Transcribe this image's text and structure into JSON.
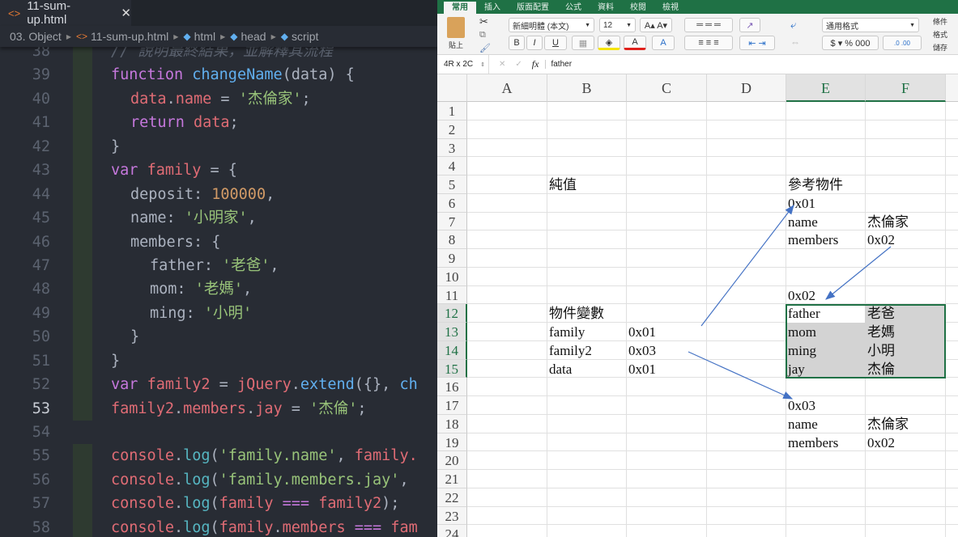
{
  "editor": {
    "tab": {
      "title": "11-sum-up.html",
      "close": "✕",
      "icon": "<>"
    },
    "breadcrumbs": [
      "03. Object",
      "11-sum-up.html",
      "html",
      "head",
      "script"
    ],
    "current_line": 53,
    "lines": [
      {
        "n": 38,
        "ind": 0,
        "t": [
          [
            "// 說明最終結果，並解釋其流程",
            "c"
          ]
        ]
      },
      {
        "n": 39,
        "ind": 0,
        "t": [
          [
            "function ",
            "k"
          ],
          [
            "changeName",
            "f"
          ],
          [
            "(data) {",
            "p"
          ]
        ]
      },
      {
        "n": 40,
        "ind": 1,
        "t": [
          [
            "data",
            "v"
          ],
          [
            ".",
            "p"
          ],
          [
            "name",
            "v"
          ],
          [
            " = ",
            "p"
          ],
          [
            "'杰倫家'",
            "s"
          ],
          [
            ";",
            "p"
          ]
        ]
      },
      {
        "n": 41,
        "ind": 1,
        "t": [
          [
            "return ",
            "k"
          ],
          [
            "data",
            "v"
          ],
          [
            ";",
            "p"
          ]
        ]
      },
      {
        "n": 42,
        "ind": 0,
        "t": [
          [
            "}",
            "p"
          ]
        ]
      },
      {
        "n": 43,
        "ind": 0,
        "t": [
          [
            "var ",
            "k"
          ],
          [
            "family",
            "v"
          ],
          [
            " = {",
            "p"
          ]
        ]
      },
      {
        "n": 44,
        "ind": 1,
        "t": [
          [
            "deposit: ",
            "p"
          ],
          [
            "100000",
            "n"
          ],
          [
            ",",
            "p"
          ]
        ]
      },
      {
        "n": 45,
        "ind": 1,
        "t": [
          [
            "name: ",
            "p"
          ],
          [
            "'小明家'",
            "s"
          ],
          [
            ",",
            "p"
          ]
        ]
      },
      {
        "n": 46,
        "ind": 1,
        "t": [
          [
            "members: {",
            "p"
          ]
        ]
      },
      {
        "n": 47,
        "ind": 2,
        "t": [
          [
            "father: ",
            "p"
          ],
          [
            "'老爸'",
            "s"
          ],
          [
            ",",
            "p"
          ]
        ]
      },
      {
        "n": 48,
        "ind": 2,
        "t": [
          [
            "mom: ",
            "p"
          ],
          [
            "'老媽'",
            "s"
          ],
          [
            ",",
            "p"
          ]
        ]
      },
      {
        "n": 49,
        "ind": 2,
        "t": [
          [
            "ming: ",
            "p"
          ],
          [
            "'小明'",
            "s"
          ]
        ]
      },
      {
        "n": 50,
        "ind": 1,
        "t": [
          [
            "}",
            "p"
          ]
        ]
      },
      {
        "n": 51,
        "ind": 0,
        "t": [
          [
            "}",
            "p"
          ]
        ]
      },
      {
        "n": 52,
        "ind": 0,
        "t": [
          [
            "var ",
            "k"
          ],
          [
            "family2",
            "v"
          ],
          [
            " = ",
            "p"
          ],
          [
            "jQuery",
            "v"
          ],
          [
            ".",
            "p"
          ],
          [
            "extend",
            "f"
          ],
          [
            "({}, ",
            "p"
          ],
          [
            "ch",
            "f"
          ]
        ]
      },
      {
        "n": 53,
        "ind": 0,
        "t": [
          [
            "family2",
            "v"
          ],
          [
            ".",
            "p"
          ],
          [
            "members",
            "v"
          ],
          [
            ".",
            "p"
          ],
          [
            "jay",
            "v"
          ],
          [
            " = ",
            "p"
          ],
          [
            "'杰倫'",
            "s"
          ],
          [
            ";",
            "p"
          ]
        ]
      },
      {
        "n": 54,
        "ind": 0,
        "t": []
      },
      {
        "n": 55,
        "ind": 0,
        "t": [
          [
            "console",
            "v"
          ],
          [
            ".",
            "p"
          ],
          [
            "log",
            "m"
          ],
          [
            "(",
            "p"
          ],
          [
            "'family.name'",
            "s"
          ],
          [
            ", ",
            "p"
          ],
          [
            "family.",
            "v"
          ]
        ]
      },
      {
        "n": 56,
        "ind": 0,
        "t": [
          [
            "console",
            "v"
          ],
          [
            ".",
            "p"
          ],
          [
            "log",
            "m"
          ],
          [
            "(",
            "p"
          ],
          [
            "'family.members.jay'",
            "s"
          ],
          [
            ",",
            "p"
          ]
        ]
      },
      {
        "n": 57,
        "ind": 0,
        "t": [
          [
            "console",
            "v"
          ],
          [
            ".",
            "p"
          ],
          [
            "log",
            "m"
          ],
          [
            "(",
            "p"
          ],
          [
            "family",
            "v"
          ],
          [
            " === ",
            "k"
          ],
          [
            "family2",
            "v"
          ],
          [
            ");",
            "p"
          ]
        ]
      },
      {
        "n": 58,
        "ind": 0,
        "t": [
          [
            "console",
            "v"
          ],
          [
            ".",
            "p"
          ],
          [
            "log",
            "m"
          ],
          [
            "(",
            "p"
          ],
          [
            "family",
            "v"
          ],
          [
            ".",
            "p"
          ],
          [
            "members",
            "v"
          ],
          [
            " === ",
            "k"
          ],
          [
            "fam",
            "v"
          ]
        ]
      }
    ]
  },
  "excel": {
    "ribbon_tabs": [
      "常用",
      "插入",
      "版面配置",
      "公式",
      "資料",
      "校閱",
      "檢視"
    ],
    "active_tab": "常用",
    "paste_label": "貼上",
    "font_name": "新細明體 (本文)",
    "font_size": "12",
    "number_format": "通用格式",
    "bold": "B",
    "italic": "I",
    "underline": "U",
    "right_labels": [
      "條件",
      "格式",
      "儲存"
    ],
    "name_box": "4R x 2C",
    "fx": "fx",
    "formula_value": "father",
    "columns": [
      "A",
      "B",
      "C",
      "D",
      "E",
      "F"
    ],
    "selected_columns": [
      "E",
      "F"
    ],
    "row_count": 24,
    "selected_rows": [
      12,
      13,
      14,
      15
    ],
    "cells": [
      {
        "r": 5,
        "c": "B",
        "v": "純值"
      },
      {
        "r": 5,
        "c": "E",
        "v": "參考物件"
      },
      {
        "r": 6,
        "c": "E",
        "v": "0x01"
      },
      {
        "r": 7,
        "c": "E",
        "v": "name"
      },
      {
        "r": 7,
        "c": "F",
        "v": "杰倫家"
      },
      {
        "r": 8,
        "c": "E",
        "v": "members"
      },
      {
        "r": 8,
        "c": "F",
        "v": "0x02"
      },
      {
        "r": 11,
        "c": "E",
        "v": "0x02"
      },
      {
        "r": 12,
        "c": "B",
        "v": "物件變數"
      },
      {
        "r": 12,
        "c": "E",
        "v": "father"
      },
      {
        "r": 12,
        "c": "F",
        "v": "老爸"
      },
      {
        "r": 13,
        "c": "B",
        "v": "family"
      },
      {
        "r": 13,
        "c": "C",
        "v": "0x01"
      },
      {
        "r": 13,
        "c": "E",
        "v": "mom"
      },
      {
        "r": 13,
        "c": "F",
        "v": "老媽"
      },
      {
        "r": 14,
        "c": "B",
        "v": "family2"
      },
      {
        "r": 14,
        "c": "C",
        "v": "0x03"
      },
      {
        "r": 14,
        "c": "E",
        "v": "ming"
      },
      {
        "r": 14,
        "c": "F",
        "v": "小明"
      },
      {
        "r": 15,
        "c": "B",
        "v": "data"
      },
      {
        "r": 15,
        "c": "C",
        "v": "0x01"
      },
      {
        "r": 15,
        "c": "E",
        "v": "jay"
      },
      {
        "r": 15,
        "c": "F",
        "v": "杰倫"
      },
      {
        "r": 17,
        "c": "E",
        "v": "0x03"
      },
      {
        "r": 18,
        "c": "E",
        "v": "name"
      },
      {
        "r": 18,
        "c": "F",
        "v": "杰倫家"
      },
      {
        "r": 19,
        "c": "E",
        "v": "members"
      },
      {
        "r": 19,
        "c": "F",
        "v": "0x02"
      }
    ],
    "arrow_color": "#4472c4"
  }
}
